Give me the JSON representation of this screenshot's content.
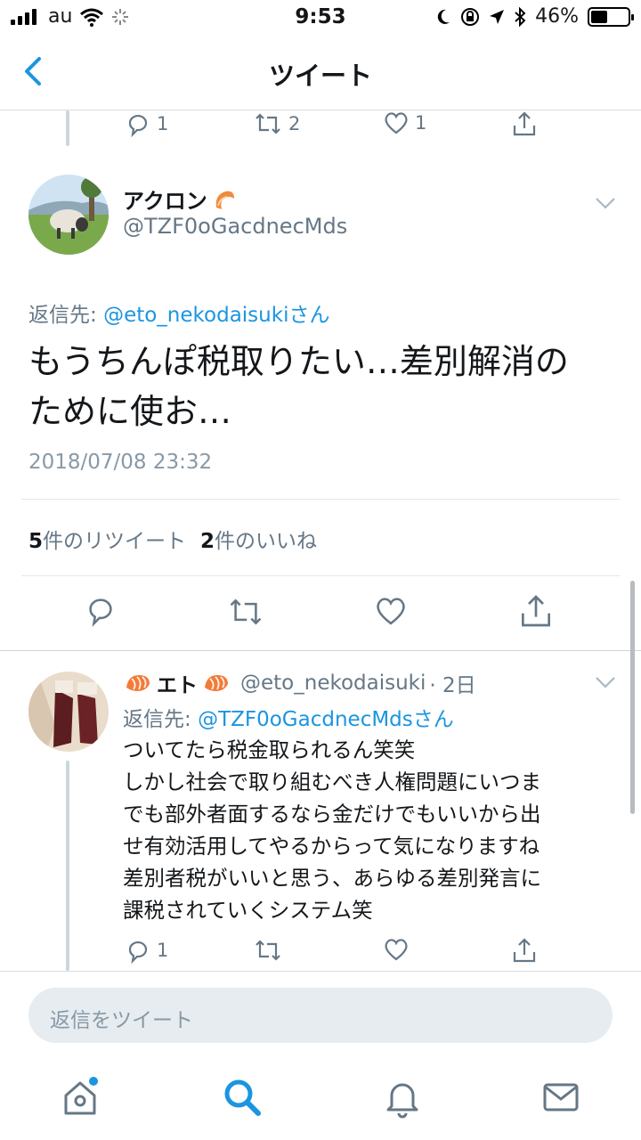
{
  "status_bar": {
    "carrier": "au",
    "time": "9:53",
    "battery": "46%"
  },
  "header": {
    "title": "ツイート"
  },
  "prev_tweet_actions": {
    "reply_count": "1",
    "retweet_count": "2",
    "like_count": "1"
  },
  "main_tweet": {
    "display_name": "アクロン",
    "handle": "@TZF0oGacdnecMds",
    "reply_prefix": "返信先: ",
    "reply_to": "@eto_nekodaisukiさん",
    "text_line1": "もうちんぽ税取りたい…差別解消の",
    "text_line2": "ために使お…",
    "timestamp": "2018/07/08 23:32",
    "retweets_num": "5",
    "retweets_label": "件のリツイート",
    "likes_num": "2",
    "likes_label": "件のいいね"
  },
  "reply_tweet": {
    "display_name": "エト",
    "handle": "@eto_nekodaisuki",
    "time": "· 2日",
    "reply_prefix": "返信先: ",
    "reply_to": "@TZF0oGacdnecMdsさん",
    "lines": [
      "ついてたら税金取られるん笑笑",
      "しかし社会で取り組むべき人権問題にいつま",
      "でも部外者面するなら金だけでもいいから出",
      "せ有効活用してやるからって気になりますね",
      "差別者税がいいと思う、あらゆる差別発言に",
      "課税されていくシステム笑"
    ],
    "reply_count": "1"
  },
  "composer": {
    "placeholder": "返信をツイート"
  },
  "colors": {
    "accent": "#1b95e0",
    "muted": "#657786"
  },
  "icons": [
    "back-chevron-icon",
    "reply-icon",
    "retweet-icon",
    "like-icon",
    "share-icon",
    "home-icon",
    "search-icon",
    "notifications-icon",
    "messages-icon",
    "chevron-down-icon",
    "shrimp-emoji-icon"
  ]
}
